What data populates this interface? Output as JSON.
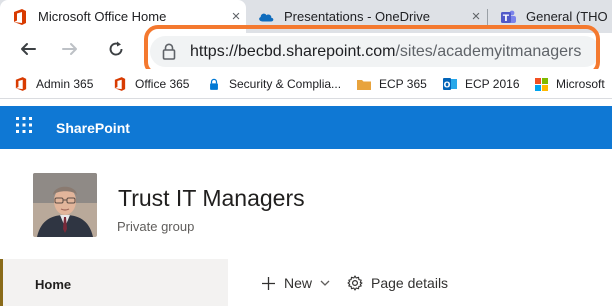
{
  "browser": {
    "tabs": [
      {
        "title": "Microsoft Office Home",
        "icon": "office-icon",
        "active": true
      },
      {
        "title": "Presentations - OneDrive",
        "icon": "onedrive-icon",
        "active": false
      },
      {
        "title": "General (THO ICT",
        "icon": "teams-icon",
        "active": false
      }
    ],
    "close_glyph": "×",
    "address": {
      "scheme_host": "https://becbd.sharepoint.com",
      "path": "/sites/academyitmanagers"
    },
    "highlight_color": "#f4792f",
    "bookmarks": [
      {
        "label": "Admin 365",
        "icon": "office-icon"
      },
      {
        "label": "Office 365",
        "icon": "office-icon"
      },
      {
        "label": "Security & Complia...",
        "icon": "lock-icon"
      },
      {
        "label": "ECP 365",
        "icon": "folder-icon"
      },
      {
        "label": "ECP 2016",
        "icon": "outlook-icon"
      },
      {
        "label": "Microsoft",
        "icon": "microsoft-icon"
      }
    ]
  },
  "sharepoint": {
    "app_name": "SharePoint",
    "brand_color": "#0f78d4",
    "site_title": "Trust IT Managers",
    "site_subtitle": "Private group",
    "nav": {
      "home": "Home"
    },
    "commands": {
      "new": "New",
      "page_details": "Page details"
    }
  }
}
